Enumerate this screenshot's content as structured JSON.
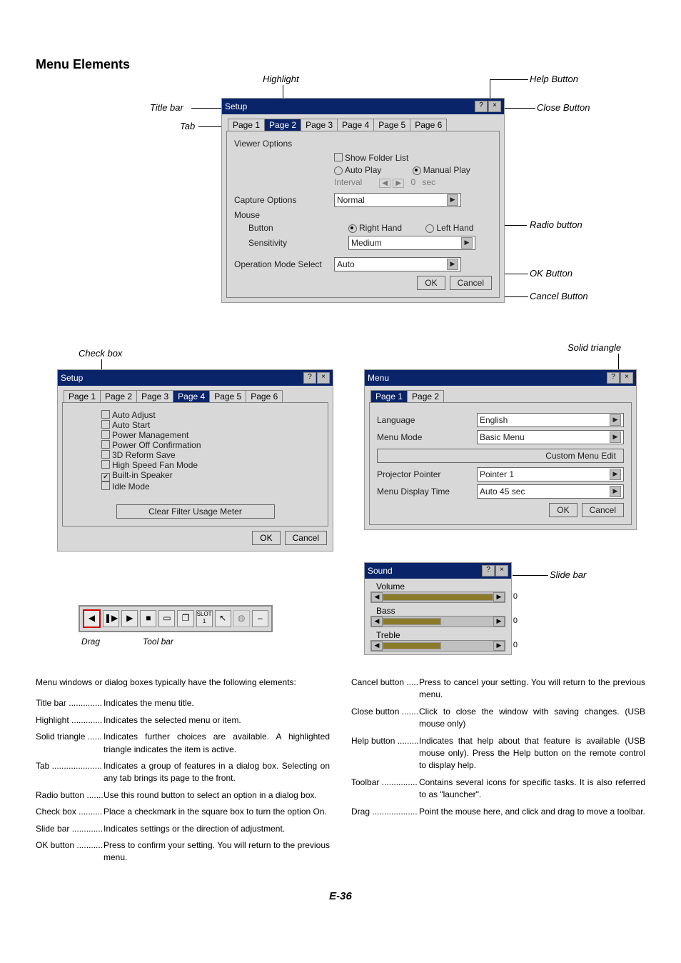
{
  "page": {
    "heading": "Menu Elements",
    "footer": "E-36"
  },
  "fig1": {
    "title": "Setup",
    "tabs": [
      "Page 1",
      "Page 2",
      "Page 3",
      "Page 4",
      "Page 5",
      "Page 6"
    ],
    "selected_tab_index": 1,
    "viewer_options_label": "Viewer Options",
    "show_folder_label": "Show Folder List",
    "auto_play_label": "Auto Play",
    "manual_play_label": "Manual Play",
    "interval_label": "Interval",
    "interval_value": "0",
    "interval_unit": "sec",
    "capture_label": "Capture Options",
    "capture_value": "Normal",
    "mouse_label": "Mouse",
    "button_label": "Button",
    "right_hand_label": "Right Hand",
    "left_hand_label": "Left Hand",
    "sensitivity_label": "Sensitivity",
    "sensitivity_value": "Medium",
    "opmode_label": "Operation Mode Select",
    "opmode_value": "Auto",
    "ok": "OK",
    "cancel": "Cancel",
    "callouts": {
      "titlebar": "Title bar",
      "highlight": "Highlight",
      "help": "Help Button",
      "close": "Close Button",
      "tab": "Tab",
      "radio": "Radio button",
      "okb": "OK Button",
      "cancelb": "Cancel Button"
    }
  },
  "fig2": {
    "title": "Setup",
    "tabs": [
      "Page 1",
      "Page 2",
      "Page 3",
      "Page 4",
      "Page 5",
      "Page 6"
    ],
    "selected_tab_index": 3,
    "items": [
      {
        "label": "Auto Adjust",
        "checked": false
      },
      {
        "label": "Auto Start",
        "checked": false
      },
      {
        "label": "Power Management",
        "checked": false
      },
      {
        "label": "Power Off Confirmation",
        "checked": false
      },
      {
        "label": "3D Reform Save",
        "checked": false
      },
      {
        "label": "High Speed Fan Mode",
        "checked": false
      },
      {
        "label": "Built-in Speaker",
        "checked": true
      },
      {
        "label": "Idle Mode",
        "checked": false
      }
    ],
    "clear_btn": "Clear Filter Usage Meter",
    "ok": "OK",
    "cancel": "Cancel",
    "callout_checkbox": "Check box"
  },
  "fig3": {
    "title": "Menu",
    "tabs": [
      "Page 1",
      "Page 2"
    ],
    "selected_tab_index": 0,
    "rows": [
      {
        "label": "Language",
        "value": "English"
      },
      {
        "label": "Menu Mode",
        "value": "Basic Menu"
      }
    ],
    "custom_btn": "Custom Menu Edit",
    "rows2": [
      {
        "label": "Projector Pointer",
        "value": "Pointer 1"
      },
      {
        "label": "Menu Display Time",
        "value": "Auto 45 sec"
      }
    ],
    "ok": "OK",
    "cancel": "Cancel",
    "callout_solid_triangle": "Solid triangle"
  },
  "fig4": {
    "title": "Sound",
    "volume_label": "Volume",
    "volume_val": "0",
    "bass_label": "Bass",
    "bass_val": "0",
    "treble_label": "Treble",
    "treble_val": "0",
    "callout_slide": "Slide bar"
  },
  "toolbar": {
    "callout_drag": "Drag",
    "callout_toolbar": "Tool bar"
  },
  "defs_intro": "Menu windows or dialog boxes typically have the following elements:",
  "defs_left": [
    {
      "term": "Title bar ..............",
      "desc": "Indicates the menu title."
    },
    {
      "term": "Highlight .............",
      "desc": "Indicates the selected menu or item."
    },
    {
      "term": "Solid triangle ......",
      "desc": "Indicates further choices are available. A highlighted triangle indicates the item is active."
    },
    {
      "term": "Tab .....................",
      "desc": "Indicates a group of features in a dialog box. Selecting on any tab brings its page to the front."
    },
    {
      "term": "Radio button .......",
      "desc": "Use this round button to select an option in a dialog box."
    },
    {
      "term": "Check box ..........",
      "desc": "Place a checkmark in the square box to turn the option On."
    },
    {
      "term": "Slide bar .............",
      "desc": "Indicates settings or the direction of adjustment."
    },
    {
      "term": "OK button ...........",
      "desc": "Press to confirm your setting. You will return to the previous menu."
    }
  ],
  "defs_right": [
    {
      "term": "Cancel button .....",
      "desc": "Press to cancel your setting. You will return to the previous menu."
    },
    {
      "term": "Close button .......",
      "desc": "Click to close the window with saving changes. (USB mouse only)"
    },
    {
      "term": "Help button .........",
      "desc": "Indicates that help about that feature is available (USB mouse only). Press the Help button on the remote control to display help."
    },
    {
      "term": "Toolbar ...............",
      "desc": "Contains several icons for specific tasks. It is also referred to as \"launcher\"."
    },
    {
      "term": "Drag ...................",
      "desc": "Point the mouse here, and click and drag to move a toolbar."
    }
  ]
}
